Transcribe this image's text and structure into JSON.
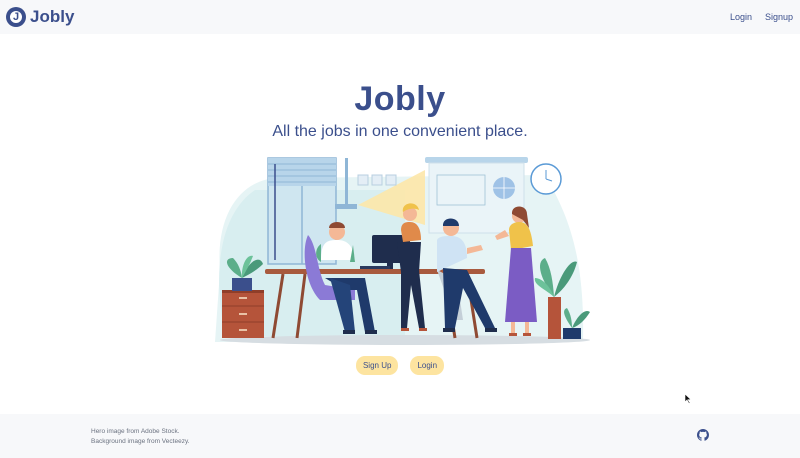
{
  "navbar": {
    "brand": "Jobly",
    "brand_initial": "J",
    "links": [
      "Login",
      "Signup"
    ]
  },
  "hero": {
    "title": "Jobly",
    "tagline": "All the jobs in one convenient place.",
    "image_icon": "office-team-illustration"
  },
  "buttons": {
    "signup": "Sign Up",
    "login": "Login"
  },
  "footer": {
    "credit_hero": "Hero image from Adobe Stock.",
    "credit_background": "Background image from Vecteezy.",
    "github_icon": "github-icon"
  },
  "colors": {
    "brand": "#3b4f8c",
    "button": "#fde4a0",
    "nav_bg": "#f7f8fa"
  }
}
